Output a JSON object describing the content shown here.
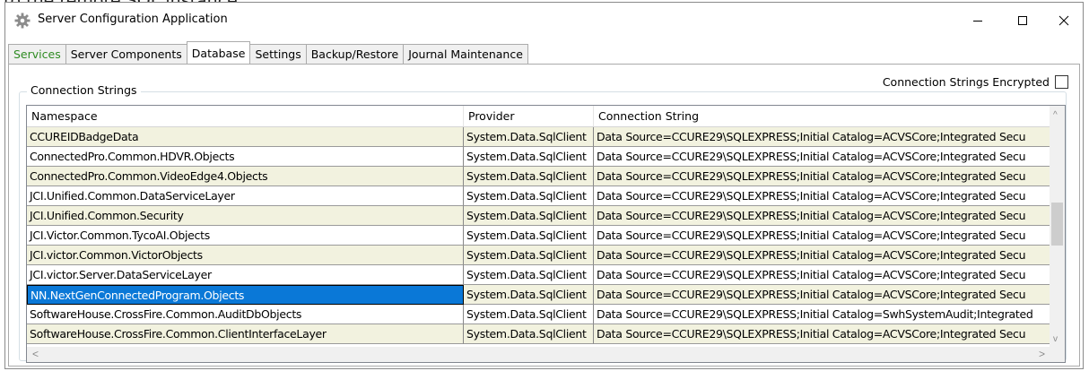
{
  "background_text": "to the remote SQL instance.",
  "window": {
    "title": "Server Configuration Application",
    "icon": "gear-icon",
    "controls": {
      "minimize": "–",
      "maximize": "☐",
      "close": "✕"
    }
  },
  "tabs": [
    {
      "label": "Services",
      "color": "#2e8b22"
    },
    {
      "label": "Server Components"
    },
    {
      "label": "Database",
      "active": true
    },
    {
      "label": "Settings"
    },
    {
      "label": "Backup/Restore"
    },
    {
      "label": "Journal Maintenance"
    }
  ],
  "encrypt_option": {
    "label": "Connection Strings Encrypted",
    "checked": false
  },
  "group": {
    "label": "Connection Strings"
  },
  "grid": {
    "columns": [
      "Namespace",
      "Provider",
      "Connection String"
    ],
    "rows": [
      [
        "CCUREIDBadgeData",
        "System.Data.SqlClient",
        "Data Source=CCURE29\\SQLEXPRESS;Initial Catalog=ACVSCore;Integrated Secu"
      ],
      [
        "ConnectedPro.Common.HDVR.Objects",
        "System.Data.SqlClient",
        "Data Source=CCURE29\\SQLEXPRESS;Initial Catalog=ACVSCore;Integrated Secu"
      ],
      [
        "ConnectedPro.Common.VideoEdge4.Objects",
        "System.Data.SqlClient",
        "Data Source=CCURE29\\SQLEXPRESS;Initial Catalog=ACVSCore;Integrated Secu"
      ],
      [
        "JCI.Unified.Common.DataServiceLayer",
        "System.Data.SqlClient",
        "Data Source=CCURE29\\SQLEXPRESS;Initial Catalog=ACVSCore;Integrated Secu"
      ],
      [
        "JCI.Unified.Common.Security",
        "System.Data.SqlClient",
        "Data Source=CCURE29\\SQLEXPRESS;Initial Catalog=ACVSCore;Integrated Secu"
      ],
      [
        "JCI.Victor.Common.TycoAI.Objects",
        "System.Data.SqlClient",
        "Data Source=CCURE29\\SQLEXPRESS;Initial Catalog=ACVSCore;Integrated Secu"
      ],
      [
        "JCI.victor.Common.VictorObjects",
        "System.Data.SqlClient",
        "Data Source=CCURE29\\SQLEXPRESS;Initial Catalog=ACVSCore;Integrated Secu"
      ],
      [
        "JCI.victor.Server.DataServiceLayer",
        "System.Data.SqlClient",
        "Data Source=CCURE29\\SQLEXPRESS;Initial Catalog=ACVSCore;Integrated Secu"
      ],
      [
        "NN.NextGenConnectedProgram.Objects",
        "System.Data.SqlClient",
        "Data Source=CCURE29\\SQLEXPRESS;Initial Catalog=ACVSCore;Integrated Secu"
      ],
      [
        "SoftwareHouse.CrossFire.Common.AuditDbObjects",
        "System.Data.SqlClient",
        "Data Source=CCURE29\\SQLEXPRESS;Initial Catalog=SwhSystemAudit;Integrated"
      ],
      [
        "SoftwareHouse.CrossFire.Common.ClientInterfaceLayer",
        "System.Data.SqlClient",
        "Data Source=CCURE29\\SQLEXPRESS;Initial Catalog=ACVSCore;Integrated Secu"
      ]
    ],
    "selected_row_index": 8,
    "colors": {
      "alt_row": "#f2f2df",
      "selected": "#0a78d7"
    }
  }
}
